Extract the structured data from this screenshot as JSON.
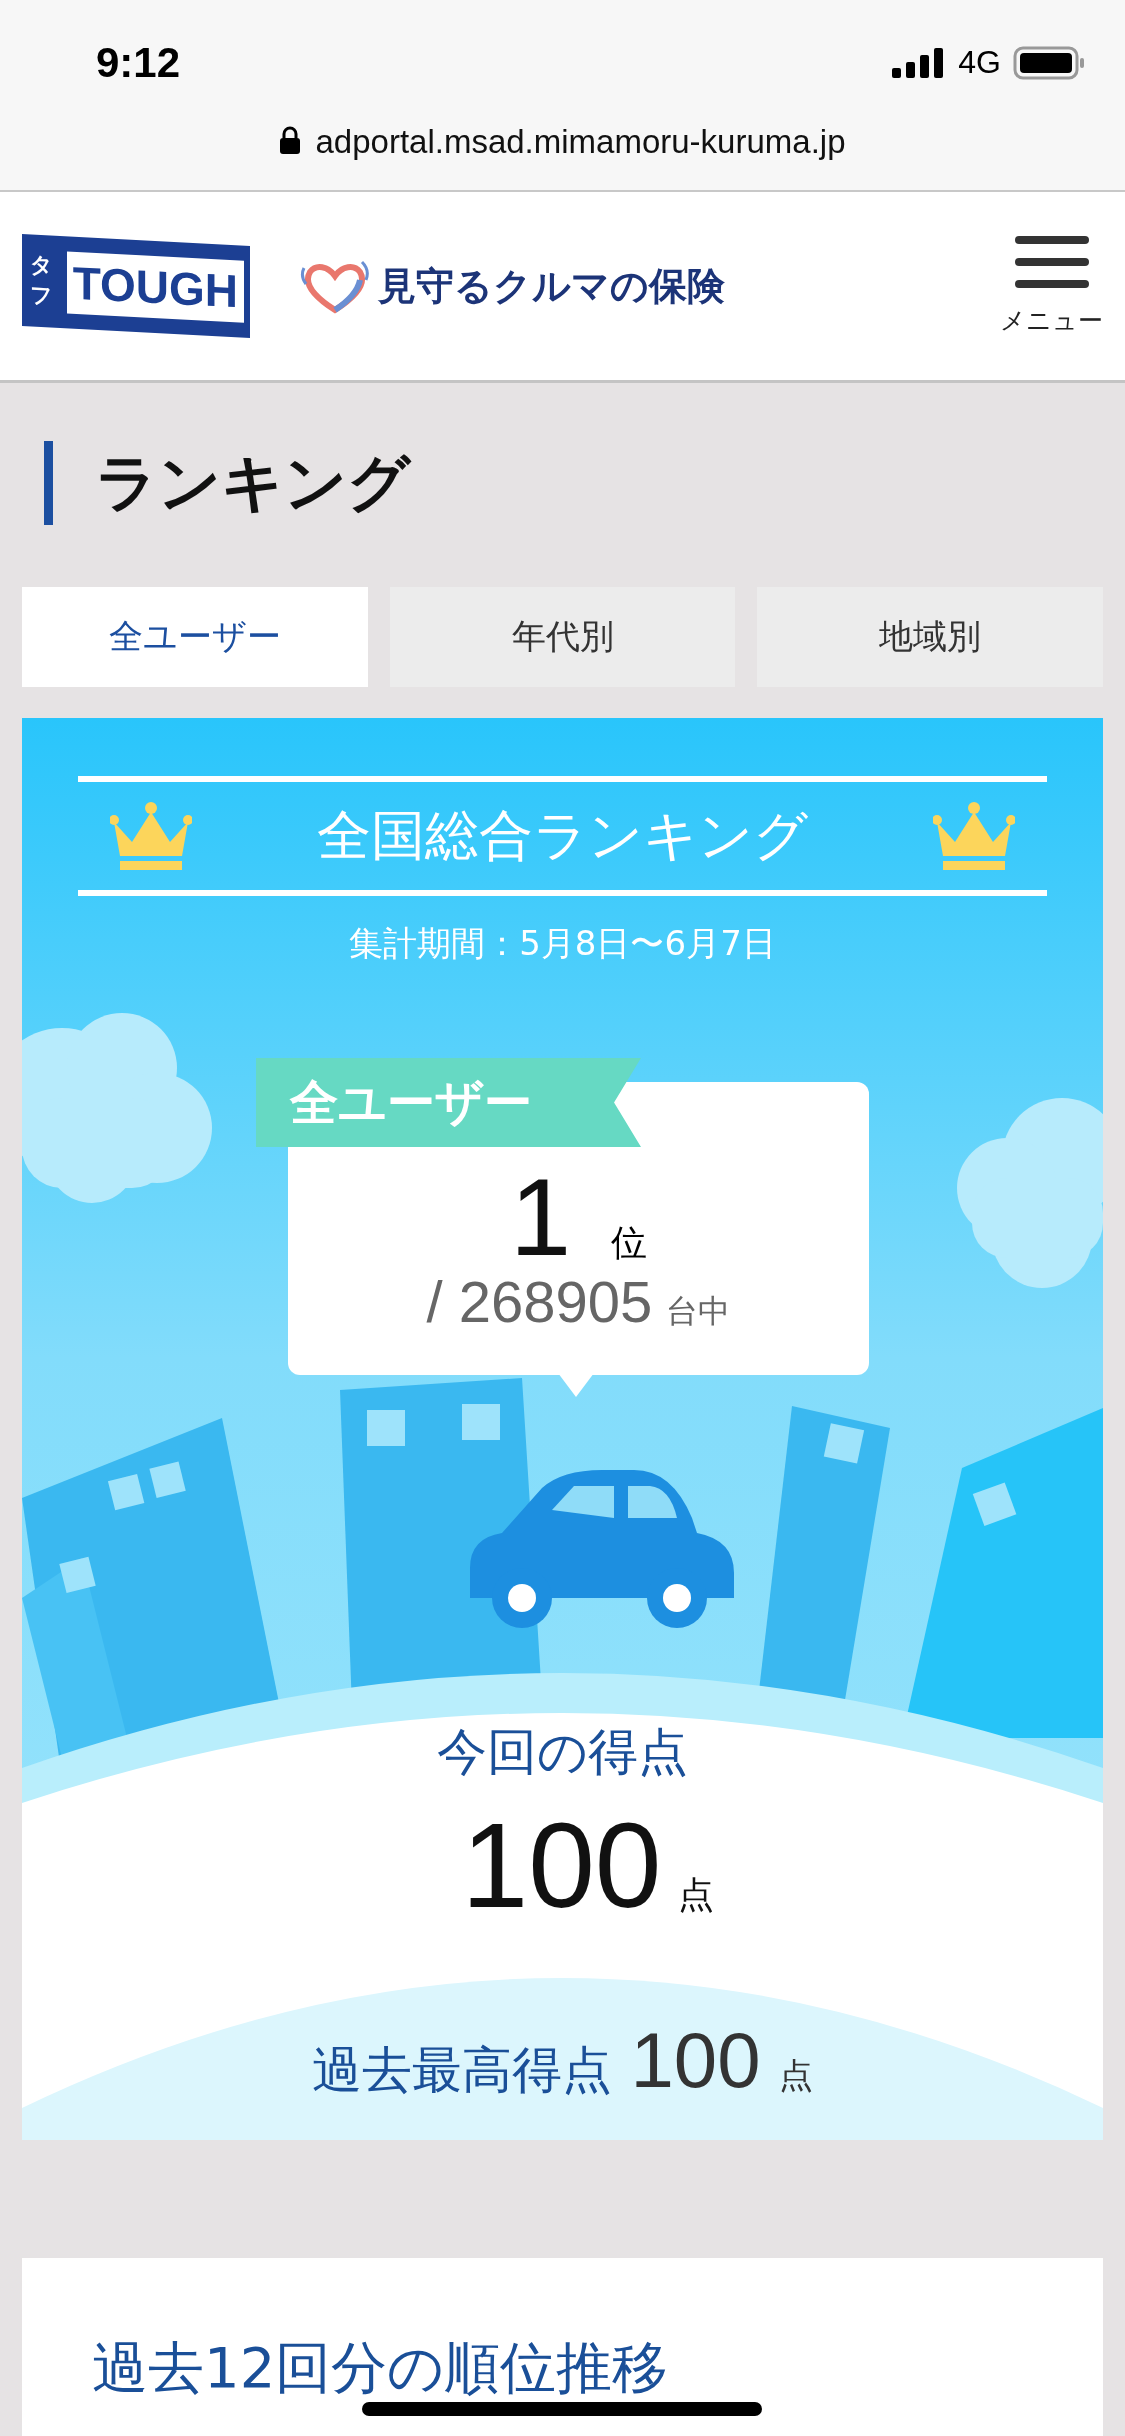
{
  "status_bar": {
    "time": "9:12",
    "network": "4G"
  },
  "browser": {
    "url": "adportal.msad.mimamoru-kuruma.jp"
  },
  "header": {
    "logo": {
      "side": "タフ",
      "main": "TOUGH"
    },
    "brand": "見守るクルマの保険",
    "menu_label": "メニュー"
  },
  "page_title": "ランキング",
  "tabs": [
    {
      "label": "全ユーザー",
      "selected": true
    },
    {
      "label": "年代別",
      "selected": false
    },
    {
      "label": "地域別",
      "selected": false
    }
  ],
  "ranking": {
    "title": "全国総合ランキング",
    "period": "集計期間：5月8日〜6月7日",
    "tag": "全ユーザー",
    "rank": "1",
    "rank_unit": "位",
    "total": "/ 268905",
    "total_unit": "台中",
    "score_label": "今回の得点",
    "score": "100",
    "score_unit": "点",
    "best_label": "過去最高得点",
    "best": "100",
    "best_unit": "点"
  },
  "history": {
    "title": "過去12回分の順位推移"
  }
}
